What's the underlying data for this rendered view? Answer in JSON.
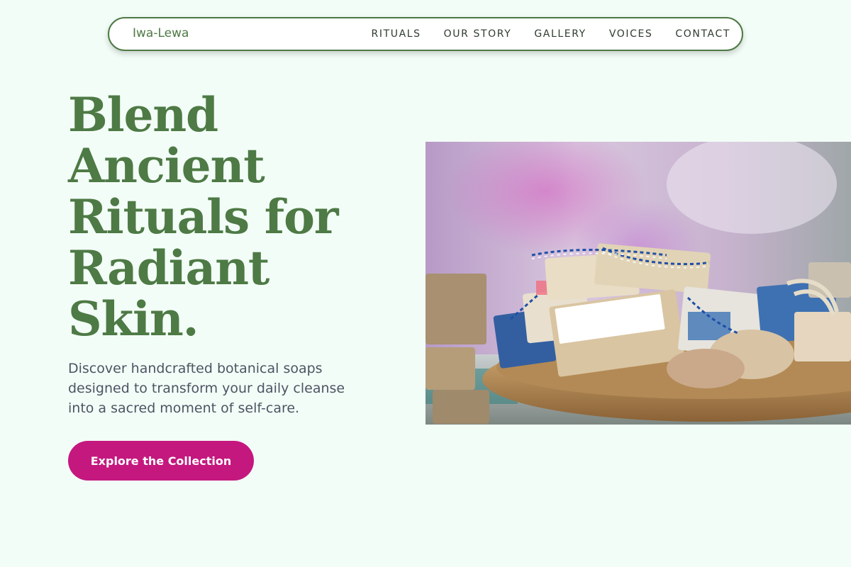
{
  "brand": {
    "name": "Iwa-Lewa"
  },
  "nav": {
    "links": [
      {
        "label": "RITUALS"
      },
      {
        "label": "OUR STORY"
      },
      {
        "label": "GALLERY"
      },
      {
        "label": "VOICES"
      },
      {
        "label": "CONTACT"
      }
    ]
  },
  "hero": {
    "title_lines": [
      "Blend",
      "Ancient",
      "Rituals for",
      "Radiant",
      "Skin."
    ],
    "subtitle": "Discover handcrafted botanical soaps designed to transform your daily cleanse into a sacred moment of self-care.",
    "cta_label": "Explore the Collection",
    "image_alt": "Handcrafted soap bars tied with blue-and-white twine in a wooden bowl"
  },
  "colors": {
    "page_bg": "#f3fdf7",
    "brand_green": "#4e7a45",
    "cta_magenta": "#c4187f",
    "nav_text": "#2f3b2f",
    "body_text": "#4b5563"
  },
  "icons": {
    "hero_image": "soap-photo-illustration"
  }
}
